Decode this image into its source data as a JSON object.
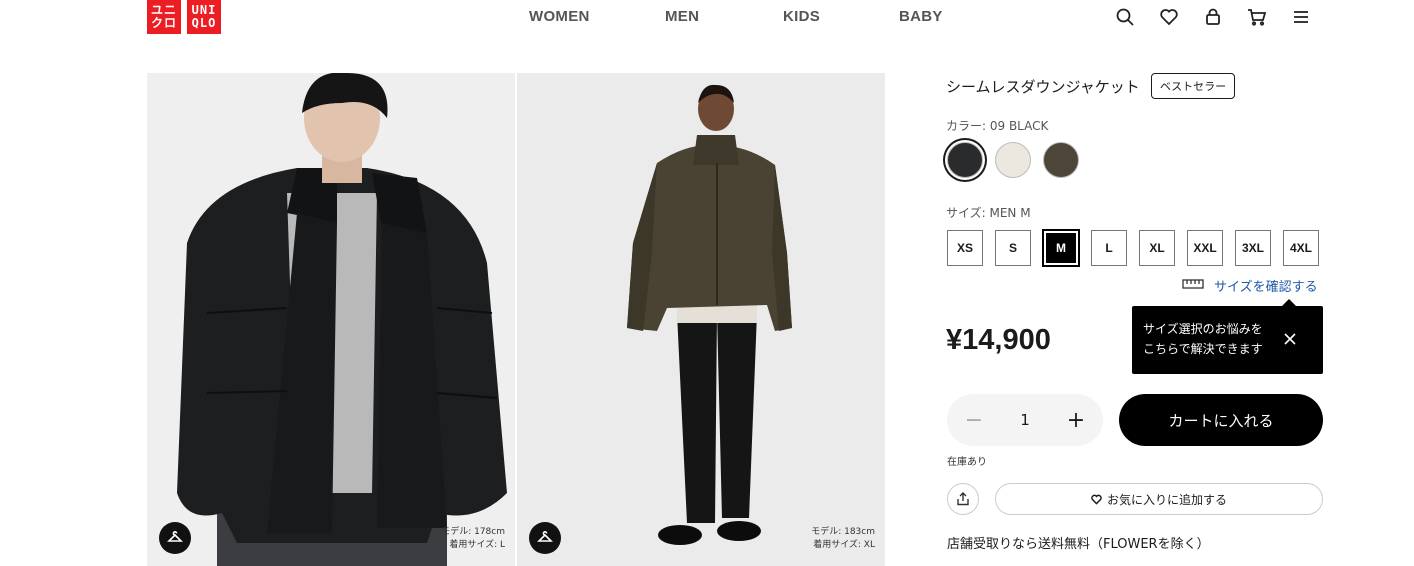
{
  "header": {
    "logo_top": "ユニ\nクロ",
    "logo_bottom": "UNI\nQLO",
    "nav": [
      "WOMEN",
      "MEN",
      "KIDS",
      "BABY"
    ],
    "icons": [
      "search-icon",
      "heart-icon",
      "user-icon",
      "cart-icon",
      "menu-icon"
    ]
  },
  "gallery": {
    "images": [
      {
        "note_line1": "モデル: 178cm",
        "note_line2": "着用サイズ: L"
      },
      {
        "note_line1": "モデル: 183cm",
        "note_line2": "着用サイズ: XL"
      }
    ]
  },
  "product": {
    "name": "シームレスダウンジャケット",
    "badge": "ベストセラー",
    "color_label": "カラー: 09 BLACK",
    "colors": [
      {
        "name": "BLACK",
        "hex": "#2a2b2d",
        "selected": true
      },
      {
        "name": "OFF WHITE",
        "hex": "#ece8df",
        "selected": false
      },
      {
        "name": "OLIVE",
        "hex": "#4d4638",
        "selected": false
      }
    ],
    "size_label": "サイズ: MEN M",
    "sizes": [
      "XS",
      "S",
      "M",
      "L",
      "XL",
      "XXL",
      "3XL",
      "4XL"
    ],
    "selected_size": "M",
    "size_check": "サイズを確認する",
    "tooltip_line1": "サイズ選択のお悩みを",
    "tooltip_line2": "こちらで解決できます",
    "price": "¥14,900",
    "quantity": "1",
    "qty_minus": "−",
    "qty_plus": "+",
    "cart_button": "カートに入れる",
    "stock": "在庫あり",
    "favorite": "お気に入りに追加する",
    "shipping_note": "店舗受取りなら送料無料（FLOWERを除く）"
  },
  "colors": {
    "brand_red": "#ed1d24",
    "link_blue": "#1f5aa6"
  }
}
